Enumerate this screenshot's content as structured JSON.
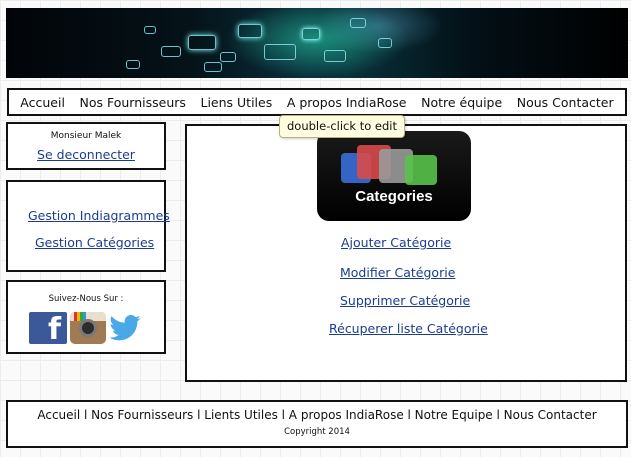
{
  "nav": {
    "items": [
      "Accueil",
      "Nos Fournisseurs",
      "Liens Utiles",
      "A propos IndiaRose",
      "Notre équipe",
      "Nous Contacter"
    ]
  },
  "tooltip": "double-click to edit",
  "user": {
    "name": "Monsieur Malek",
    "logout": "Se deconnecter"
  },
  "management": {
    "items": [
      "Gestion Indiagrammes",
      "Gestion Catégories"
    ]
  },
  "social": {
    "title": "Suivez-Nous Sur :",
    "icons": [
      "facebook-icon",
      "instagram-icon",
      "twitter-icon"
    ]
  },
  "content": {
    "icon_label": "Categories",
    "actions": [
      "Ajouter Catégorie",
      "Modifier Catégorie",
      "Supprimer Catégorie",
      "Récuperer liste Catégorie"
    ]
  },
  "footer": {
    "links": "Accueil l Nos Fournisseurs l Lients Utiles l A propos IndiaRose l Notre Equipe l Nous Contacter",
    "copyright": "Copyright 2014"
  },
  "colors": {
    "link": "#1b3d8f",
    "facebook": "#3b5998",
    "twitter": "#4aa8e6"
  }
}
